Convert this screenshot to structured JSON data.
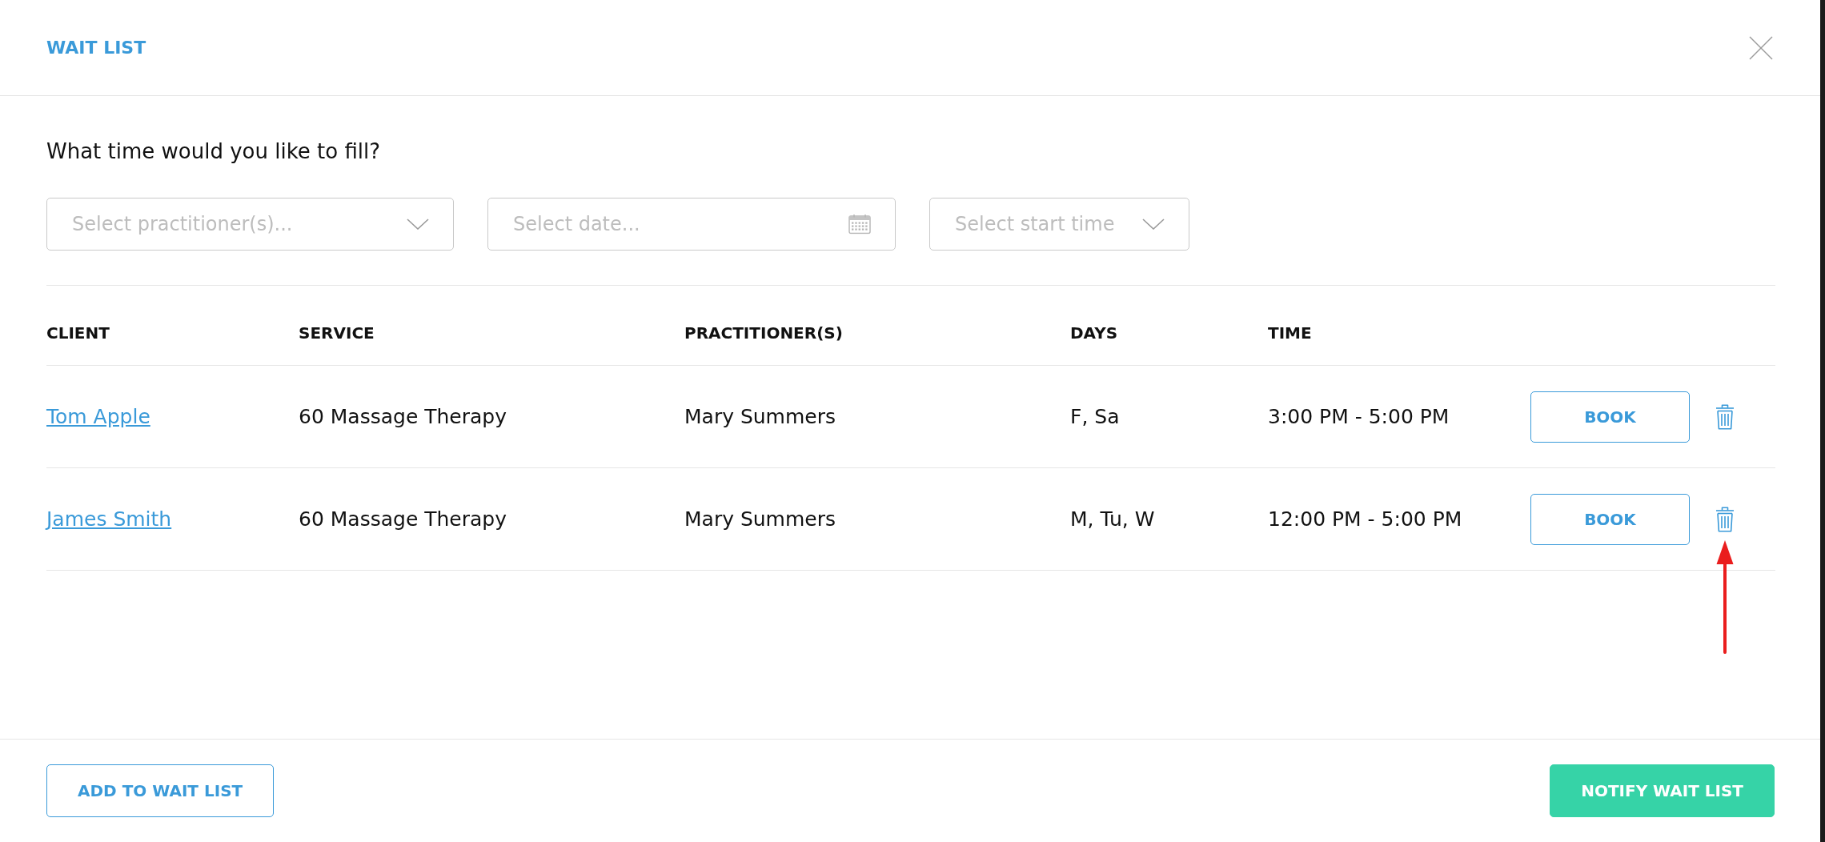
{
  "dialog": {
    "title": "WAIT LIST"
  },
  "filters": {
    "prompt": "What time would you like to fill?",
    "fields": [
      {
        "kind": "dropdown",
        "placeholder": "Select practitioner(s)..."
      },
      {
        "kind": "date",
        "placeholder": "Select date..."
      },
      {
        "kind": "dropdown",
        "placeholder": "Select start time"
      }
    ]
  },
  "table": {
    "columns": [
      "CLIENT",
      "SERVICE",
      "PRACTITIONER(S)",
      "DAYS",
      "TIME"
    ],
    "rows": [
      {
        "client": "Tom Apple",
        "service": "60 Massage Therapy",
        "practitioners": "Mary Summers",
        "days": "F, Sa",
        "time": "3:00 PM - 5:00 PM",
        "action": "BOOK",
        "annotated": false
      },
      {
        "client": "James Smith",
        "service": "60 Massage Therapy",
        "practitioners": "Mary Summers",
        "days": "M, Tu, W",
        "time": "12:00 PM - 5:00 PM",
        "action": "BOOK",
        "annotated": true
      }
    ]
  },
  "footer": {
    "buttons": [
      {
        "kind": "secondary",
        "label": "ADD TO WAIT LIST"
      },
      {
        "kind": "primary",
        "label": "NOTIFY WAIT LIST"
      }
    ]
  }
}
